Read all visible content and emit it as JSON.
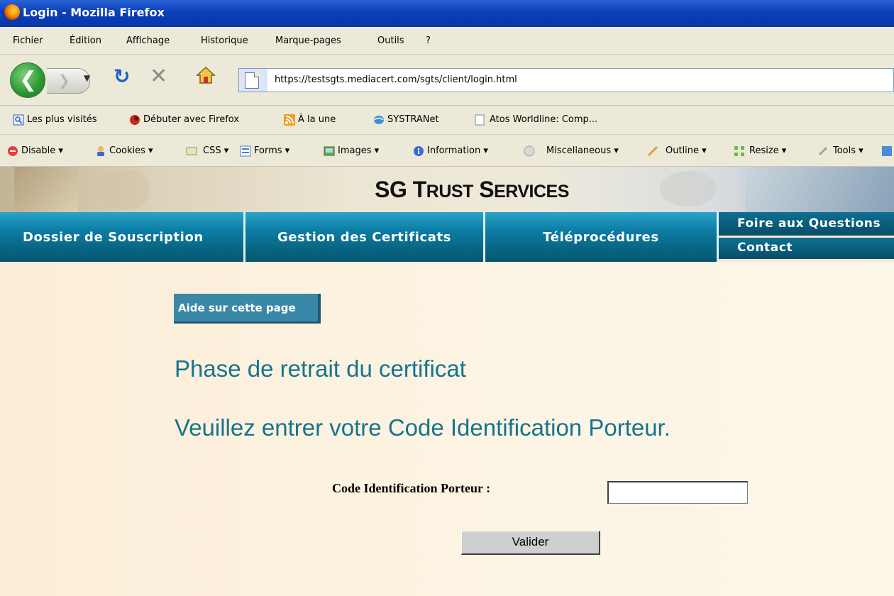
{
  "window": {
    "title": "Login - Mozilla Firefox"
  },
  "menubar": {
    "items": [
      "Fichier",
      "Édition",
      "Affichage",
      "Historique",
      "Marque-pages",
      "Outils",
      "?"
    ]
  },
  "navbar": {
    "url": "https://testsgts.mediacert.com/sgts/client/login.html"
  },
  "bookmarks": {
    "items": [
      "Les plus visités",
      "Débuter avec Firefox",
      "À la une",
      "SYSTRANet",
      "Atos Worldline: Comp..."
    ]
  },
  "devbar": {
    "items": [
      "Disable",
      "Cookies",
      "CSS",
      "Forms",
      "Images",
      "Information",
      "Miscellaneous",
      "Outline",
      "Resize",
      "Tools"
    ]
  },
  "site": {
    "brand_prefix": "SG T",
    "brand_sc1": "RUST",
    "brand_mid": " S",
    "brand_sc2": "ERVICES",
    "nav": {
      "tabs": [
        "Dossier de Souscription",
        "Gestion des Certificats",
        "Téléprocédures"
      ],
      "subtabs": [
        "Foire aux Questions",
        "Contact"
      ]
    }
  },
  "content": {
    "help_button": "Aide sur cette page",
    "heading1": "Phase de retrait du certificat",
    "heading2": "Veuillez entrer votre Code Identification Porteur.",
    "field_label": "Code Identification Porteur :",
    "field_value": "",
    "submit_label": "Valider"
  },
  "colors": {
    "titlebar": "#0a3fb8",
    "chrome": "#ece9d8",
    "nav_teal": "#0e7ea6",
    "heading_teal": "#16748e",
    "page_bg": "#fcf3e2"
  },
  "icons": {
    "back": "back-arrow-icon",
    "forward": "forward-arrow-icon",
    "reload": "reload-icon",
    "stop": "stop-icon",
    "home": "home-icon",
    "page": "page-icon"
  }
}
